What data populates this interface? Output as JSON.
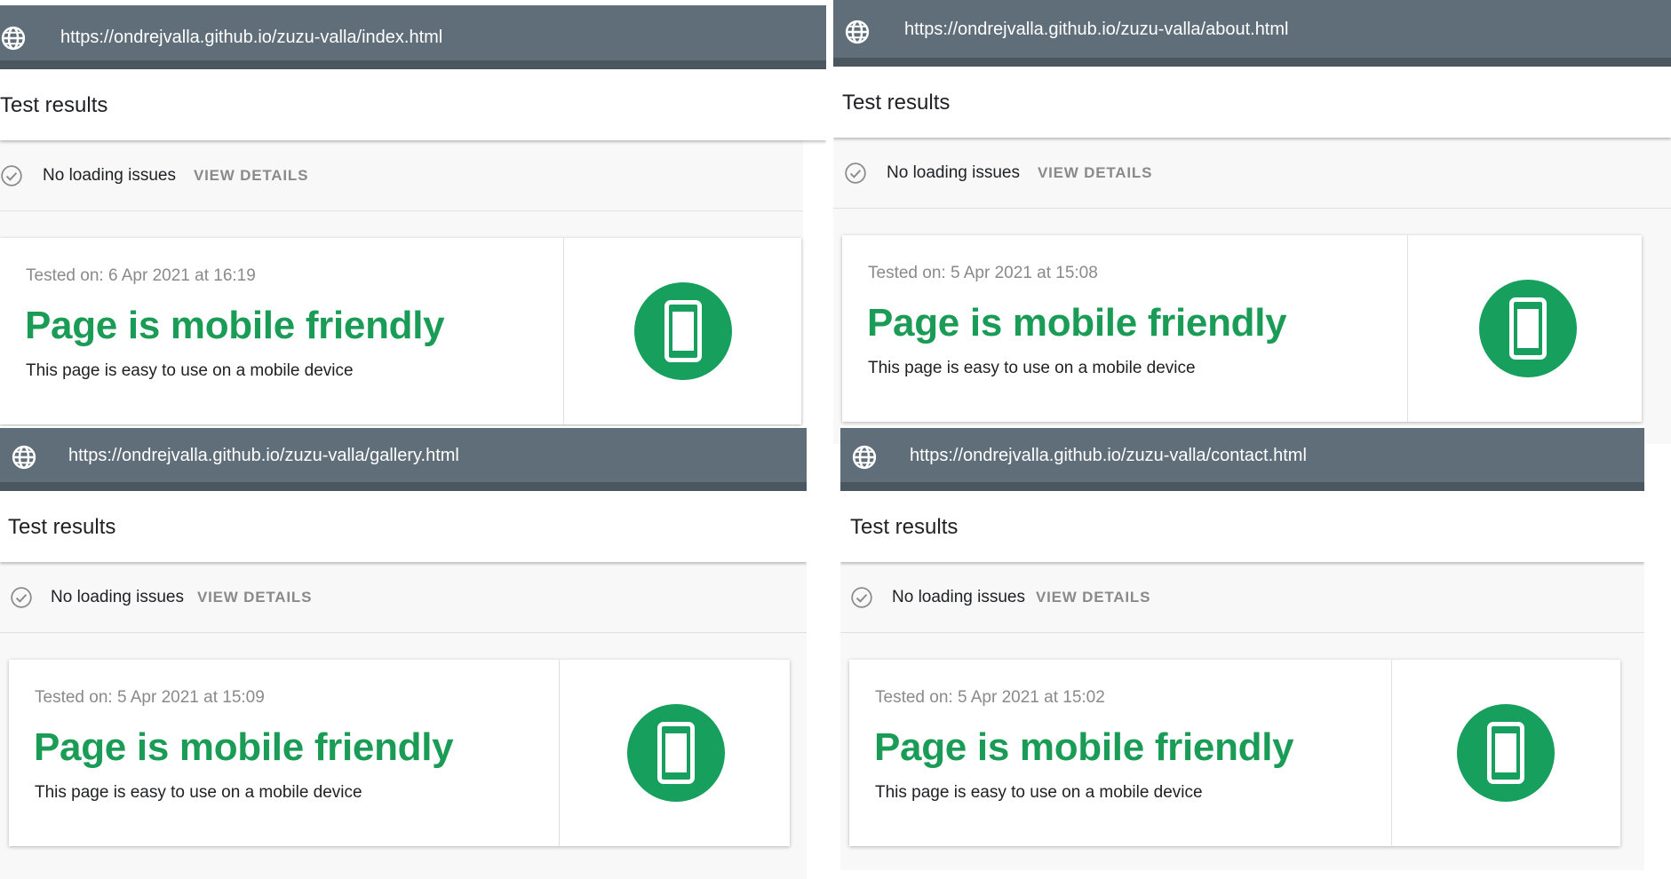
{
  "colors": {
    "url_bar": "#5f6e79",
    "accent_green": "#1a9c56",
    "muted_text": "#8a8a8a"
  },
  "icons": {
    "globe": "globe-icon",
    "check": "check-circle-icon",
    "phone": "smartphone-icon"
  },
  "panels": [
    {
      "url": "https://ondrejvalla.github.io/zuzu-valla/index.html",
      "results_title": "Test results",
      "status": "No loading issues",
      "view_details": "VIEW DETAILS",
      "tested_on": "Tested on: 6 Apr 2021 at 16:19",
      "headline": "Page is mobile friendly",
      "subline": "This page is easy to use on a mobile device"
    },
    {
      "url": "https://ondrejvalla.github.io/zuzu-valla/about.html",
      "results_title": "Test results",
      "status": "No loading issues",
      "view_details": "VIEW DETAILS",
      "tested_on": "Tested on: 5 Apr 2021 at 15:08",
      "headline": "Page is mobile friendly",
      "subline": "This page is easy to use on a mobile device"
    },
    {
      "url": "https://ondrejvalla.github.io/zuzu-valla/gallery.html",
      "results_title": "Test results",
      "status": "No loading issues",
      "view_details": "VIEW DETAILS",
      "tested_on": "Tested on: 5 Apr 2021 at 15:09",
      "headline": "Page is mobile friendly",
      "subline": "This page is easy to use on a mobile device"
    },
    {
      "url": "https://ondrejvalla.github.io/zuzu-valla/contact.html",
      "results_title": "Test results",
      "status": "No loading issues",
      "view_details": "VIEW DETAILS",
      "tested_on": "Tested on: 5 Apr 2021 at 15:02",
      "headline": "Page is mobile friendly",
      "subline": "This page is easy to use on a mobile device"
    }
  ]
}
